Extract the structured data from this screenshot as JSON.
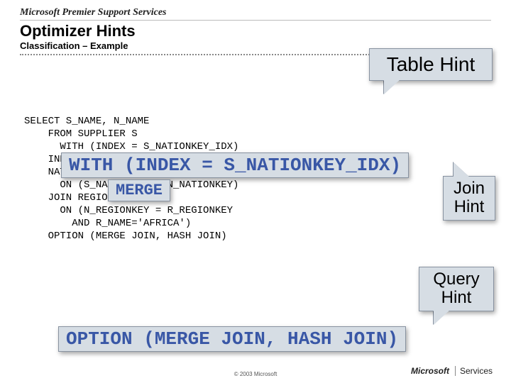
{
  "header": {
    "brand": "Microsoft Premier Support Services",
    "title": "Optimizer Hints",
    "subtitle": "Classification – Example"
  },
  "sql": "SELECT S_NAME, N_NAME\n    FROM SUPPLIER S\n      WITH (INDEX = S_NATIONKEY_IDX)\n    INNER MERGE JOIN\n    NATION N\n      ON (S_NATIONKEY = N_NATIONKEY)\n    JOIN REGION R\n      ON (N_REGIONKEY = R_REGIONKEY\n        AND R_NAME='AFRICA')\n    OPTION (MERGE JOIN, HASH JOIN)",
  "callouts": {
    "table_hint": "Table Hint",
    "join_hint_line1": "Join",
    "join_hint_line2": "Hint",
    "query_hint_line1": "Query",
    "query_hint_line2": "Hint"
  },
  "codeboxes": {
    "with_index": "WITH (INDEX = S_NATIONKEY_IDX)",
    "merge": "MERGE",
    "option": "OPTION (MERGE JOIN, HASH JOIN)"
  },
  "footer": {
    "copyright": "© 2003 Microsoft",
    "logo_l": "Microsoft",
    "logo_r": "Services"
  }
}
